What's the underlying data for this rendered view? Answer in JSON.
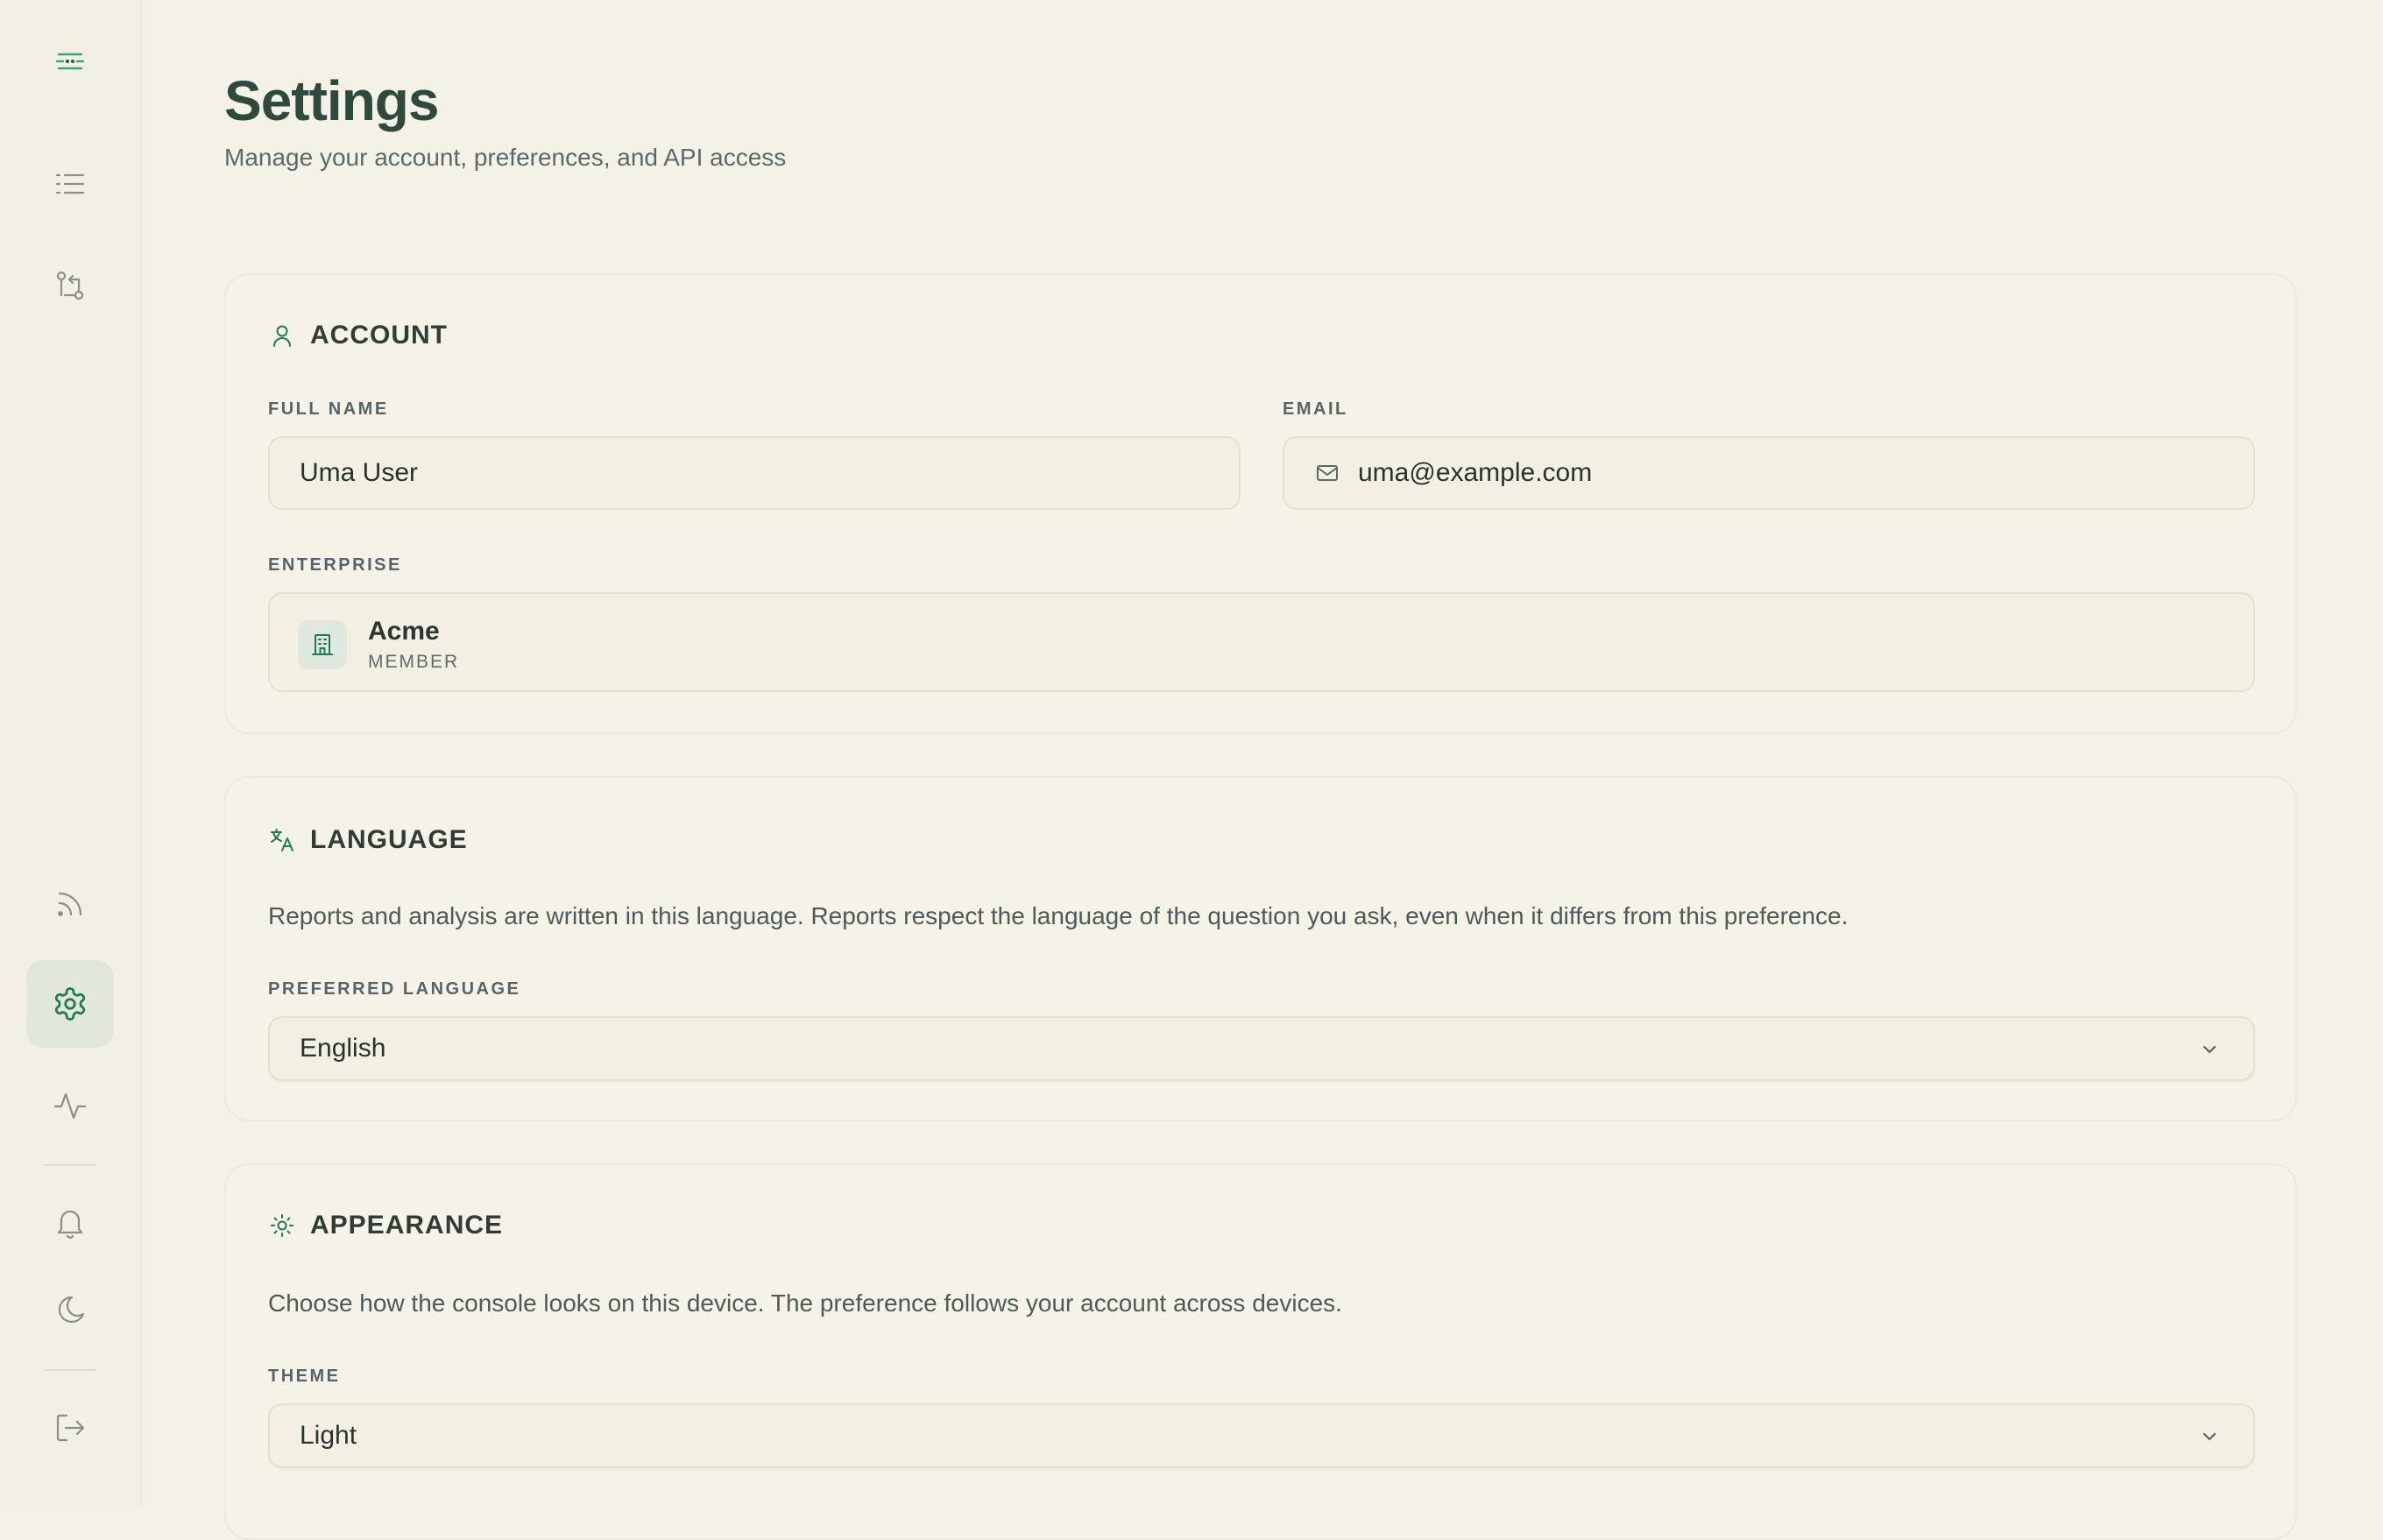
{
  "header": {
    "title": "Settings",
    "subtitle": "Manage your account, preferences, and API access"
  },
  "sidebar": {
    "top_items": [
      {
        "icon": "logo-icon"
      },
      {
        "icon": "list-icon"
      },
      {
        "icon": "git-compare-icon"
      }
    ],
    "bottom_items": [
      {
        "icon": "rss-icon"
      },
      {
        "icon": "gear-icon",
        "active": true
      },
      {
        "icon": "activity-icon"
      },
      {
        "icon": "bell-icon"
      },
      {
        "icon": "moon-icon"
      },
      {
        "icon": "logout-icon"
      }
    ]
  },
  "account": {
    "title": "ACCOUNT",
    "full_name_label": "FULL NAME",
    "full_name_value": "Uma User",
    "email_label": "EMAIL",
    "email_value": "uma@example.com",
    "enterprise_label": "ENTERPRISE",
    "enterprise_name": "Acme",
    "enterprise_role": "MEMBER"
  },
  "language": {
    "title": "LANGUAGE",
    "description": "Reports and analysis are written in this language. Reports respect the language of the question you ask, even when it differs from this preference.",
    "preferred_label": "PREFERRED LANGUAGE",
    "selected": "English"
  },
  "appearance": {
    "title": "APPEARANCE",
    "description": "Choose how the console looks on this device. The preference follows your account across devices.",
    "theme_label": "THEME",
    "selected": "Light"
  },
  "colors": {
    "accent": "#1f7a55",
    "text_dark": "#2e4a3d",
    "background": "#f4f1e7",
    "icon_muted": "#8a8f8c"
  }
}
